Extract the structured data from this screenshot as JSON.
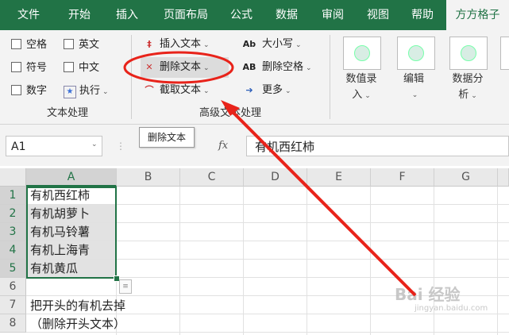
{
  "tabs": [
    "文件",
    "开始",
    "插入",
    "页面布局",
    "公式",
    "数据",
    "审阅",
    "视图",
    "帮助",
    "方方格子"
  ],
  "active_tab": "方方格子",
  "text_group": {
    "checkboxes": [
      "空格",
      "英文",
      "符号",
      "中文",
      "数字"
    ],
    "execute_label": "执行",
    "label": "文本处理"
  },
  "advanced_group": {
    "insert_text": "插入文本",
    "delete_text": "删除文本",
    "extract_text": "截取文本",
    "case": "大小写",
    "delete_spaces": "删除空格",
    "more": "更多",
    "label": "高级文本处理"
  },
  "big_buttons": {
    "numeric_entry_line1": "数值录",
    "numeric_entry_line2": "入",
    "edit": "编辑",
    "data_analysis_line1": "数据分",
    "data_analysis_line2": "析"
  },
  "tooltip": "删除文本",
  "name_box": "A1",
  "fx_symbol": "fx",
  "formula_value": "有机西红柿",
  "columns": [
    "A",
    "B",
    "C",
    "D",
    "E",
    "F",
    "G"
  ],
  "rows": [
    "1",
    "2",
    "3",
    "4",
    "5",
    "6",
    "7",
    "8"
  ],
  "cells": [
    "有机西红柿",
    "有机胡萝卜",
    "有机马铃薯",
    "有机上海青",
    "有机黄瓜"
  ],
  "note_line1": "把开头的有机去掉",
  "note_line2": "（删除开头文本）",
  "watermark": "Bai 经验",
  "watermark_sub": "jingyan.baidu.com",
  "colors": {
    "ribbon_green": "#217346",
    "annotation_red": "#e8231a"
  }
}
